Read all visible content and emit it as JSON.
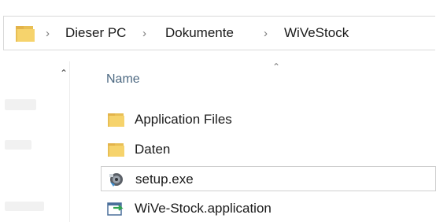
{
  "breadcrumb": {
    "items": [
      "Dieser PC",
      "Dokumente",
      "WiVeStock"
    ],
    "separator": "›"
  },
  "nav": {
    "scroll_up_glyph": "⌃"
  },
  "file_list": {
    "sort_indicator": "⌃",
    "column_name": "Name",
    "rows": [
      {
        "name": "Application Files",
        "icon": "folder-icon"
      },
      {
        "name": "Daten",
        "icon": "folder-icon"
      },
      {
        "name": "setup.exe",
        "icon": "setup-exe-icon",
        "selected": true
      },
      {
        "name": "WiVe-Stock.application",
        "icon": "application-manifest-icon"
      }
    ]
  },
  "colors": {
    "folder": "#f6d36c",
    "folder_dark": "#e3b34a",
    "header_text": "#4d6982",
    "selection_border": "#cfcfcf"
  }
}
